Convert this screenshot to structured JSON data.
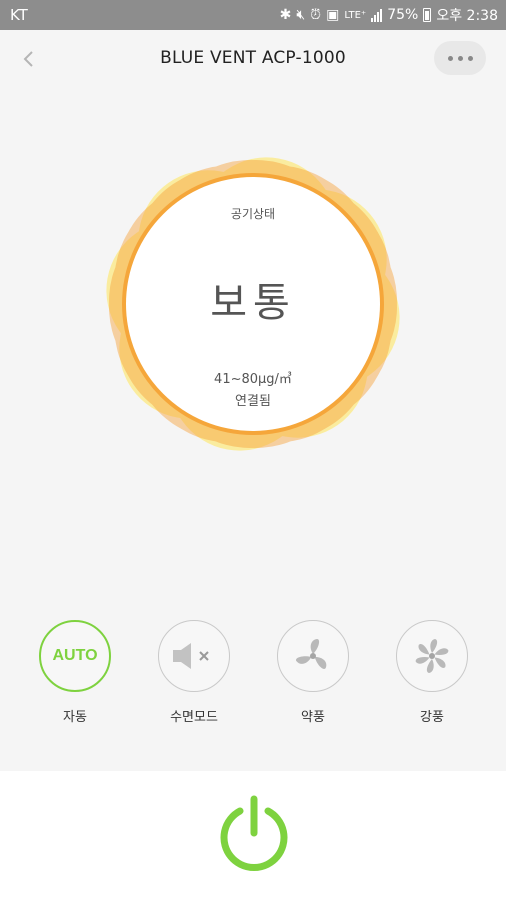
{
  "status_bar": {
    "carrier": "KT",
    "signal_label": "LTE⁺",
    "battery": "75%",
    "time": "오후 2:38"
  },
  "header": {
    "title": "BLUE VENT ACP-1000",
    "back_icon": "chevron-left-icon",
    "more_icon": "more-horizontal-icon"
  },
  "air_quality": {
    "caption": "공기상태",
    "level": "보통",
    "range": "41~80μg/㎥",
    "connection": "연결됨",
    "colors": {
      "outer": "#f7a23b",
      "petal": "#ffe45a",
      "ring": "#f5a63a"
    }
  },
  "modes": [
    {
      "label": "자동",
      "icon": "AUTO",
      "active": true
    },
    {
      "label": "수면모드",
      "icon": "speaker-mute-icon",
      "active": false
    },
    {
      "label": "약풍",
      "icon": "fan-low-icon",
      "active": false
    },
    {
      "label": "강풍",
      "icon": "fan-high-icon",
      "active": false
    }
  ],
  "power": {
    "icon": "power-icon",
    "color": "#7ed23f"
  }
}
